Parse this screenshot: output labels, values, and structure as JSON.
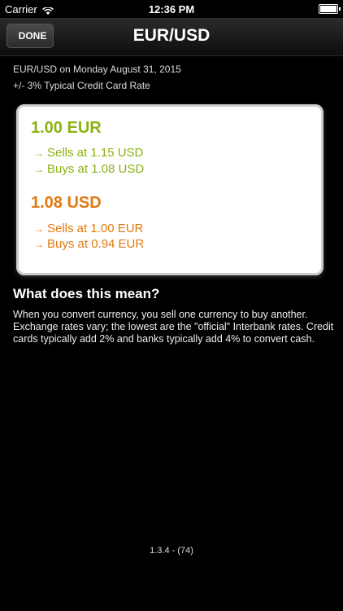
{
  "statusbar": {
    "carrier": "Carrier",
    "time": "12:36 PM"
  },
  "navbar": {
    "done_label": "DONE",
    "title": "EUR/USD"
  },
  "info": {
    "line1": "EUR/USD on Monday August 31, 2015",
    "line2": "+/- 3% Typical Credit Card Rate"
  },
  "card": {
    "eur": {
      "amount": "1.00 EUR",
      "sells": "Sells at 1.15 USD",
      "buys": "Buys at 1.08 USD",
      "color": "#8bb312"
    },
    "usd": {
      "amount": "1.08 USD",
      "sells": "Sells at 1.00 EUR",
      "buys": "Buys at 0.94 EUR",
      "color": "#e07a12"
    }
  },
  "explain": {
    "heading": "What does this mean?",
    "body": "When you convert currency, you sell one currency to buy another. Exchange rates vary; the lowest are the \"official\" Interbank rates. Credit cards typically add 2% and banks typically add 4% to convert cash."
  },
  "footer": {
    "version": "1.3.4 - (74)"
  }
}
